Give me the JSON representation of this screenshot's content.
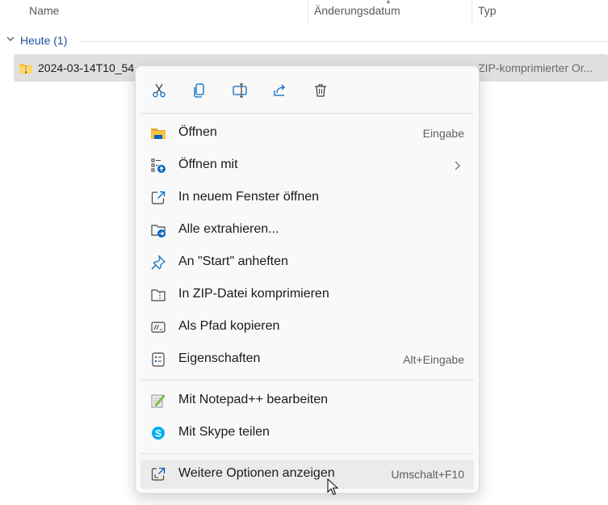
{
  "columns": {
    "name": "Name",
    "date": "Änderungsdatum",
    "type": "Typ"
  },
  "group": {
    "title": "Heute (1)"
  },
  "file": {
    "name": "2024-03-14T10_54",
    "type": "ZIP-komprimierter Or..."
  },
  "quick_actions": [
    {
      "id": "cut",
      "icon": "scissors-icon"
    },
    {
      "id": "copy",
      "icon": "copy-icon"
    },
    {
      "id": "rename",
      "icon": "rename-icon"
    },
    {
      "id": "share",
      "icon": "share-icon"
    },
    {
      "id": "delete",
      "icon": "trash-icon"
    }
  ],
  "menu": {
    "items": [
      {
        "label": "Öffnen",
        "shortcut": "Eingabe",
        "icon": "folder-icon"
      },
      {
        "label": "Öffnen mit",
        "shortcut": "",
        "icon": "open-with-icon",
        "submenu": true
      },
      {
        "label": "In neuem Fenster öffnen",
        "shortcut": "",
        "icon": "new-window-icon"
      },
      {
        "label": "Alle extrahieren...",
        "shortcut": "",
        "icon": "extract-icon"
      },
      {
        "label": "An \"Start\" anheften",
        "shortcut": "",
        "icon": "pin-icon"
      },
      {
        "label": "In ZIP-Datei komprimieren",
        "shortcut": "",
        "icon": "zip-icon"
      },
      {
        "label": "Als Pfad kopieren",
        "shortcut": "",
        "icon": "copy-path-icon"
      },
      {
        "label": "Eigenschaften",
        "shortcut": "Alt+Eingabe",
        "icon": "properties-icon"
      },
      {
        "label": "Mit Notepad++ bearbeiten",
        "shortcut": "",
        "icon": "notepadpp-icon"
      },
      {
        "label": "Mit Skype teilen",
        "shortcut": "",
        "icon": "skype-icon"
      },
      {
        "label": "Weitere Optionen anzeigen",
        "shortcut": "Umschalt+F10",
        "icon": "more-options-icon"
      }
    ]
  },
  "colors": {
    "accent": "#0067c0",
    "folder": "#f6c342",
    "skype": "#00aff0"
  }
}
